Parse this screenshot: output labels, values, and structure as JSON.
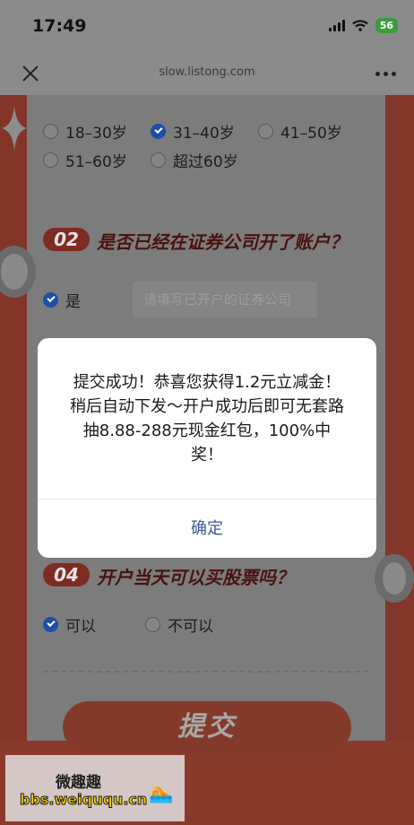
{
  "status_bar": {
    "time": "17:49",
    "battery": "56"
  },
  "nav": {
    "url": "slow.listong.com"
  },
  "age_options": [
    {
      "label": "18–30岁",
      "checked": false
    },
    {
      "label": "31–40岁",
      "checked": true
    },
    {
      "label": "41–50岁",
      "checked": false
    },
    {
      "label": "51–60岁",
      "checked": false
    },
    {
      "label": "超过60岁",
      "checked": false
    }
  ],
  "question2": {
    "number": "02",
    "title": "是否已经在证券公司开了账户？"
  },
  "account_option": {
    "label": "是",
    "checked": true
  },
  "company_input": {
    "placeholder": "请填写已开户的证券公司"
  },
  "question4": {
    "number": "04",
    "title": "开户当天可以买股票吗？"
  },
  "q4_options": [
    {
      "label": "可以",
      "checked": true
    },
    {
      "label": "不可以",
      "checked": false
    }
  ],
  "submit_label": "提交",
  "dialog": {
    "message": "提交成功！恭喜您获得1.2元立减金！稍后自动下发～开户成功后即可无套路抽8.88-288元现金红包，100%中奖！",
    "confirm_label": "确定"
  },
  "watermark": {
    "top": "微趣趣",
    "bottom": "bbs.weiququ.cn"
  }
}
